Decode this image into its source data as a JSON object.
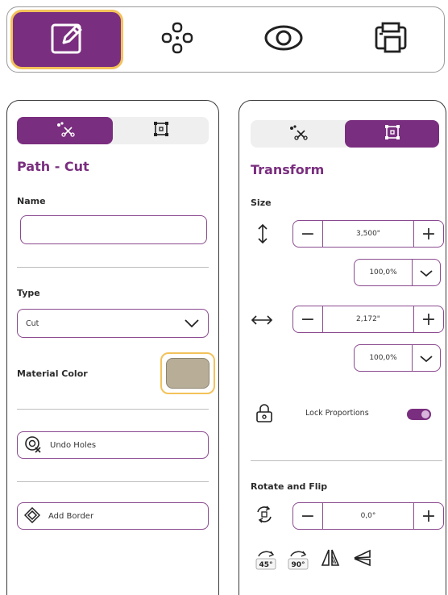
{
  "toolbar": {
    "tools": [
      {
        "name": "edit",
        "icon": "edit-icon",
        "active": true
      },
      {
        "name": "arrange",
        "icon": "arrange-icon",
        "active": false
      },
      {
        "name": "preview",
        "icon": "eye-icon",
        "active": false
      },
      {
        "name": "output",
        "icon": "printer-icon",
        "active": false
      }
    ]
  },
  "left_panel": {
    "tabs": [
      {
        "icon": "cut-path-icon",
        "selected": true
      },
      {
        "icon": "transform-icon",
        "selected": false
      }
    ],
    "title": "Path - Cut",
    "name_label": "Name",
    "name_value": "",
    "type_label": "Type",
    "type_value": "Cut",
    "material_color_label": "Material Color",
    "material_color": "#b8ae98",
    "undo_holes_label": "Undo Holes",
    "add_border_label": "Add Border"
  },
  "right_panel": {
    "tabs": [
      {
        "icon": "cut-path-icon",
        "selected": false
      },
      {
        "icon": "transform-icon",
        "selected": true
      }
    ],
    "title": "Transform",
    "size_label": "Size",
    "height_value": "3,500\"",
    "height_percent": "100,0%",
    "width_value": "2,172\"",
    "width_percent": "100,0%",
    "lock_label": "Lock Proportions",
    "lock_enabled": true,
    "rotate_flip_label": "Rotate and Flip",
    "rotation_value": "0,0°",
    "rotate_45_label": "45°",
    "rotate_90_label": "90°"
  },
  "colors": {
    "accent": "#7a2e7f",
    "highlight": "#f3c25a"
  }
}
